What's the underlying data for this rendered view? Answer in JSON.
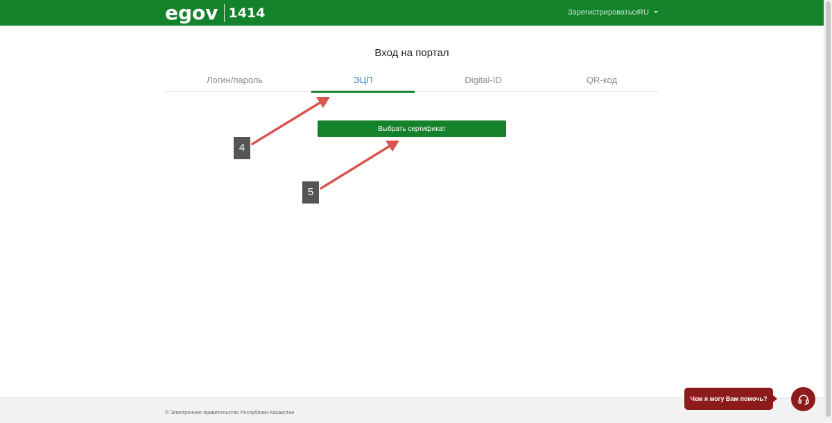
{
  "header": {
    "logo_text": "egov",
    "logo_number": "1414",
    "register_link": "Зарегистрироваться",
    "language": "RU"
  },
  "page": {
    "title": "Вход на портал"
  },
  "tabs": [
    {
      "label": "Логин/пароль",
      "active": false
    },
    {
      "label": "ЭЦП",
      "active": true
    },
    {
      "label": "Digital-ID",
      "active": false
    },
    {
      "label": "QR-код",
      "active": false
    }
  ],
  "main": {
    "select_certificate_label": "Выбрать сертификат"
  },
  "annotations": [
    {
      "label": "4"
    },
    {
      "label": "5"
    }
  ],
  "footer": {
    "copyright": "© Электронное правительство Республики Казахстан"
  },
  "help": {
    "bubble_text": "Чем я могу Вам помочь?",
    "icon": "headset-icon"
  },
  "colors": {
    "brand_green": "#14822a",
    "active_tab_text": "#2f80c4",
    "help_red": "#8e1b1b",
    "annotation_arrow": "#d9534f"
  }
}
